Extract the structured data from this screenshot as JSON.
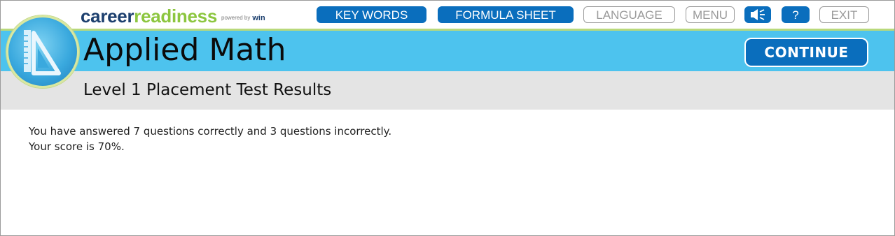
{
  "brand": {
    "part1": "career",
    "part2": "readiness",
    "powered": "powered by",
    "win": "win"
  },
  "toolbar": {
    "key_words": "KEY WORDS",
    "formula_sheet": "FORMULA SHEET",
    "language": "LANGUAGE",
    "menu": "MENU",
    "help": "?",
    "exit": "EXIT"
  },
  "header": {
    "title": "Applied Math",
    "continue": "CONTINUE"
  },
  "subheader": {
    "title": "Level 1 Placement Test Results"
  },
  "results": {
    "line1": "You have answered 7 questions correctly and 3 questions incorrectly.",
    "line2": "Your score is 70%."
  },
  "colors": {
    "toolbar_active": "#0a6ebd",
    "header_band": "#4dc3ee",
    "subheader_band": "#e4e4e4",
    "accent_green": "#8cc63f",
    "brand_navy": "#1c3f6e"
  },
  "icons": {
    "logo": "ruler-triangle-icon",
    "audio": "speaker-icon"
  }
}
